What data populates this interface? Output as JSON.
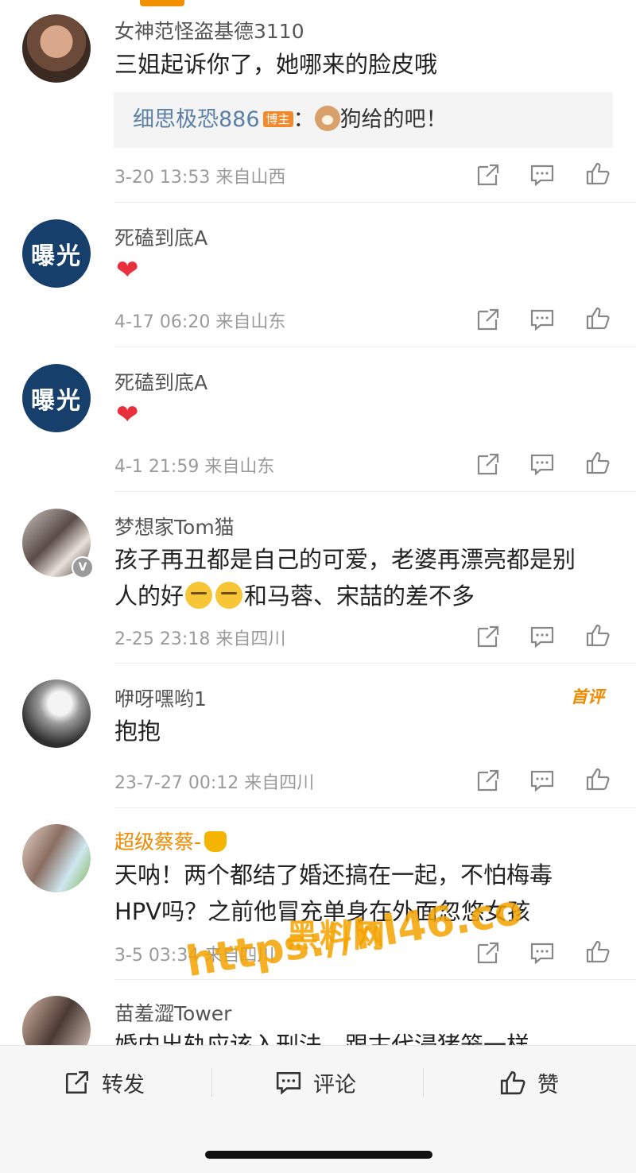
{
  "comments": [
    {
      "name": "女神范怪盗基德3110",
      "content": "三姐起诉你了，她哪来的脸皮哦",
      "reply": {
        "name": "细思极恐886",
        "tag": "博主",
        "sep": "：",
        "text": "狗给的吧！"
      },
      "meta": "3-20 13:53 来自山西"
    },
    {
      "name": "死磕到底A",
      "avatar_text": "曝光",
      "meta": "4-17 06:20 来自山东"
    },
    {
      "name": "死磕到底A",
      "avatar_text": "曝光",
      "meta": "4-1 21:59 来自山东"
    },
    {
      "name": "梦想家Tom猫",
      "content_line1": "孩子再丑都是自己的可爱，老婆再漂亮都是别",
      "content_line2_a": "人的好",
      "content_line2_b": "和马蓉、宋喆的差不多",
      "verified_badge": "V",
      "meta": "2-25 23:18 来自四川"
    },
    {
      "name": "咿呀嘿哟1",
      "badge": "首评",
      "content": "抱抱",
      "meta": "23-7-27 00:12 来自四川"
    },
    {
      "name": "超级蔡蔡-",
      "content_line1": "天呐！两个都结了婚还搞在一起，不怕梅毒",
      "content_line2": "HPV吗？之前他冒充单身在外面忽悠女孩",
      "meta": "3-5 03:34 来自四川"
    },
    {
      "name": "苗羞澀Tower",
      "content_partial": "婚内出轨应该入刑法，跟古代浸猪笼一样"
    }
  ],
  "watermark": {
    "line1": "黑料网",
    "line2": "https://hl46.co"
  },
  "bottom_bar": {
    "repost": "转发",
    "comment": "评论",
    "like": "赞"
  },
  "icons": [
    "share-icon",
    "comment-icon",
    "like-icon",
    "heart-icon"
  ],
  "colors": {
    "accent": "#f08a00",
    "reply_name": "#5b7fa6",
    "heart": "#e8313d"
  }
}
